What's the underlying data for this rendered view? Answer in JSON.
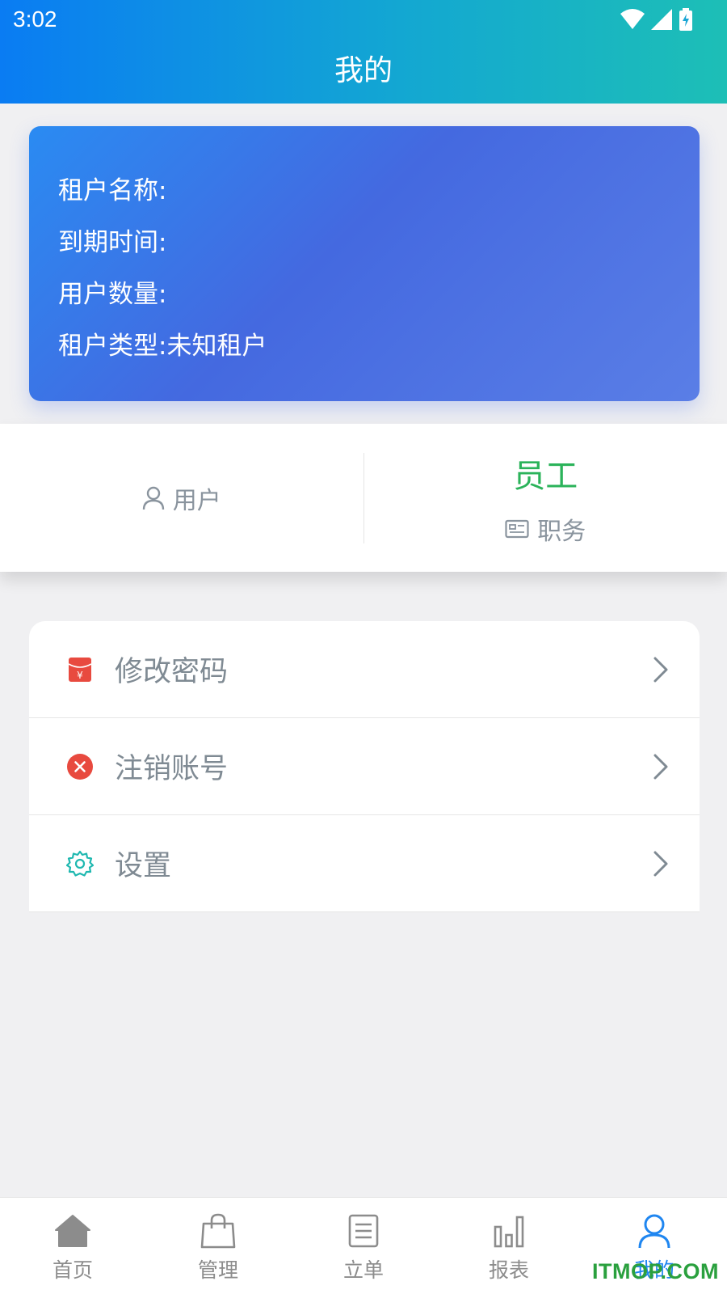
{
  "status_bar": {
    "time": "3:02"
  },
  "header": {
    "title": "我的"
  },
  "tenant": {
    "rows": [
      {
        "label": "租户名称:",
        "value": ""
      },
      {
        "label": "到期时间:",
        "value": ""
      },
      {
        "label": "用户数量:",
        "value": ""
      },
      {
        "label": "租户类型:",
        "value": "未知租户"
      }
    ]
  },
  "roles": {
    "left": {
      "label": "用户",
      "icon": "user-icon"
    },
    "right": {
      "value": "员工",
      "label": "职务",
      "icon": "id-card-icon"
    }
  },
  "menu": {
    "items": [
      {
        "label": "修改密码",
        "icon": "red-packet-icon"
      },
      {
        "label": "注销账号",
        "icon": "close-circle-icon"
      },
      {
        "label": "设置",
        "icon": "gear-icon"
      }
    ]
  },
  "nav": {
    "items": [
      {
        "label": "首页",
        "icon": "home-icon"
      },
      {
        "label": "管理",
        "icon": "bag-icon"
      },
      {
        "label": "立单",
        "icon": "document-icon"
      },
      {
        "label": "报表",
        "icon": "bar-chart-icon"
      },
      {
        "label": "我的",
        "icon": "person-icon",
        "active": true
      }
    ]
  },
  "watermark": "ITMOP.COM",
  "colors": {
    "header_start": "#0a7cf3",
    "header_end": "#1dbfb6",
    "card_blue": "#4469e0",
    "role_green": "#2bb35a",
    "nav_active": "#1f86f0",
    "icon_red": "#e84a3f",
    "icon_teal": "#1fb8b0"
  }
}
